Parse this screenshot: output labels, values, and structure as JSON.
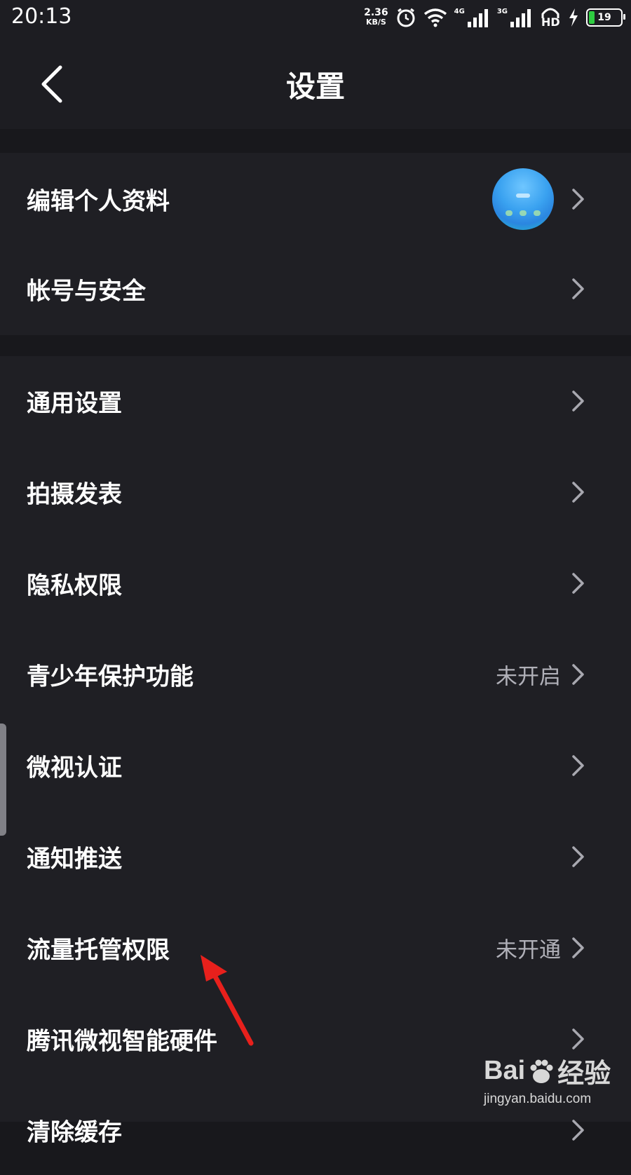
{
  "status_bar": {
    "time": "20:13",
    "speed_value": "2.36",
    "speed_unit": "KB/S",
    "network_1": "4G",
    "network_2": "3G",
    "hd": "HD",
    "battery": "19"
  },
  "header": {
    "title": "设置"
  },
  "groups": [
    {
      "items": [
        {
          "label": "编辑个人资料",
          "has_avatar": true
        },
        {
          "label": "帐号与安全"
        }
      ]
    },
    {
      "items": [
        {
          "label": "通用设置"
        },
        {
          "label": "拍摄发表"
        },
        {
          "label": "隐私权限"
        },
        {
          "label": "青少年保护功能",
          "value": "未开启"
        },
        {
          "label": "微视认证"
        },
        {
          "label": "通知推送"
        },
        {
          "label": "流量托管权限",
          "value": "未开通"
        },
        {
          "label": "腾讯微视智能硬件"
        },
        {
          "label": "清除缓存"
        }
      ]
    }
  ],
  "watermark": {
    "brand": "Bai",
    "brand_suffix": "经验",
    "site": "jingyan.baidu.com"
  },
  "colors": {
    "background": "#18181c",
    "row_background": "#1f1f24",
    "annotation_arrow": "#e8201c"
  },
  "icons": {
    "back": "back-arrow-icon",
    "chevron": "chevron-right-icon",
    "alarm": "alarm-icon",
    "wifi": "wifi-icon",
    "headphones": "headphones-icon",
    "charging": "charging-bolt-icon"
  }
}
